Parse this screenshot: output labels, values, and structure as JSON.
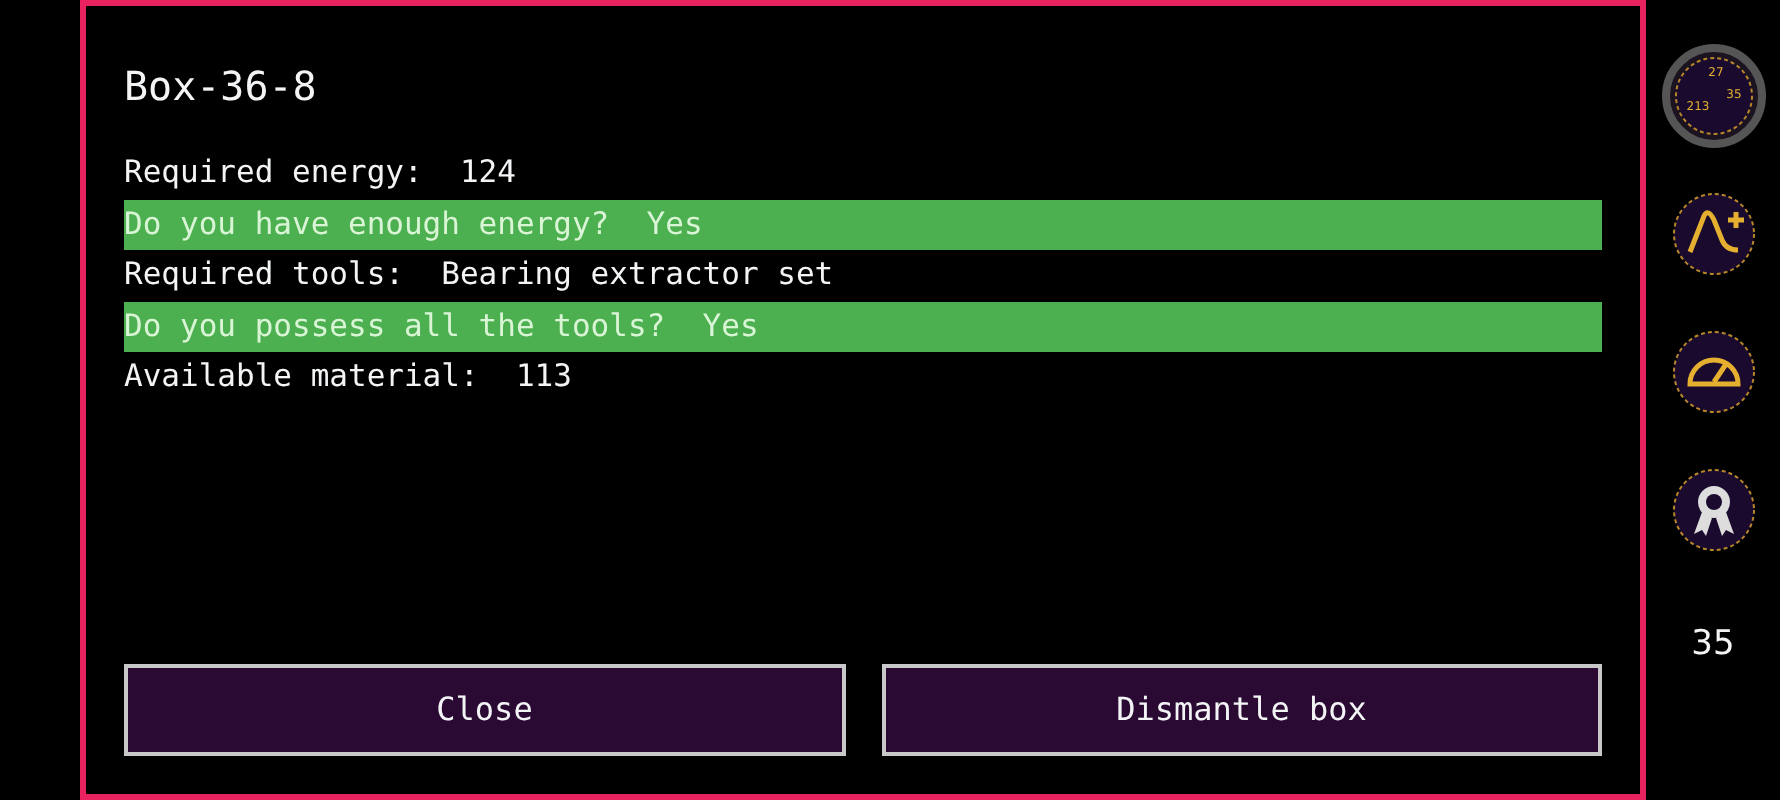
{
  "dialog": {
    "title": "Box-36-8",
    "lines": [
      {
        "text": "Required energy:  124",
        "highlighted": false
      },
      {
        "text": "Do you have enough energy?  Yes",
        "highlighted": true
      },
      {
        "text": "Required tools:  Bearing extractor set",
        "highlighted": false
      },
      {
        "text": "Do you possess all the tools?  Yes",
        "highlighted": true
      },
      {
        "text": "Available material:  113",
        "highlighted": false
      }
    ],
    "buttons": [
      "Close",
      "Dismantle box"
    ]
  },
  "sidebar": {
    "gauge_labels": [
      "27",
      "35",
      "213"
    ],
    "count": "35"
  }
}
